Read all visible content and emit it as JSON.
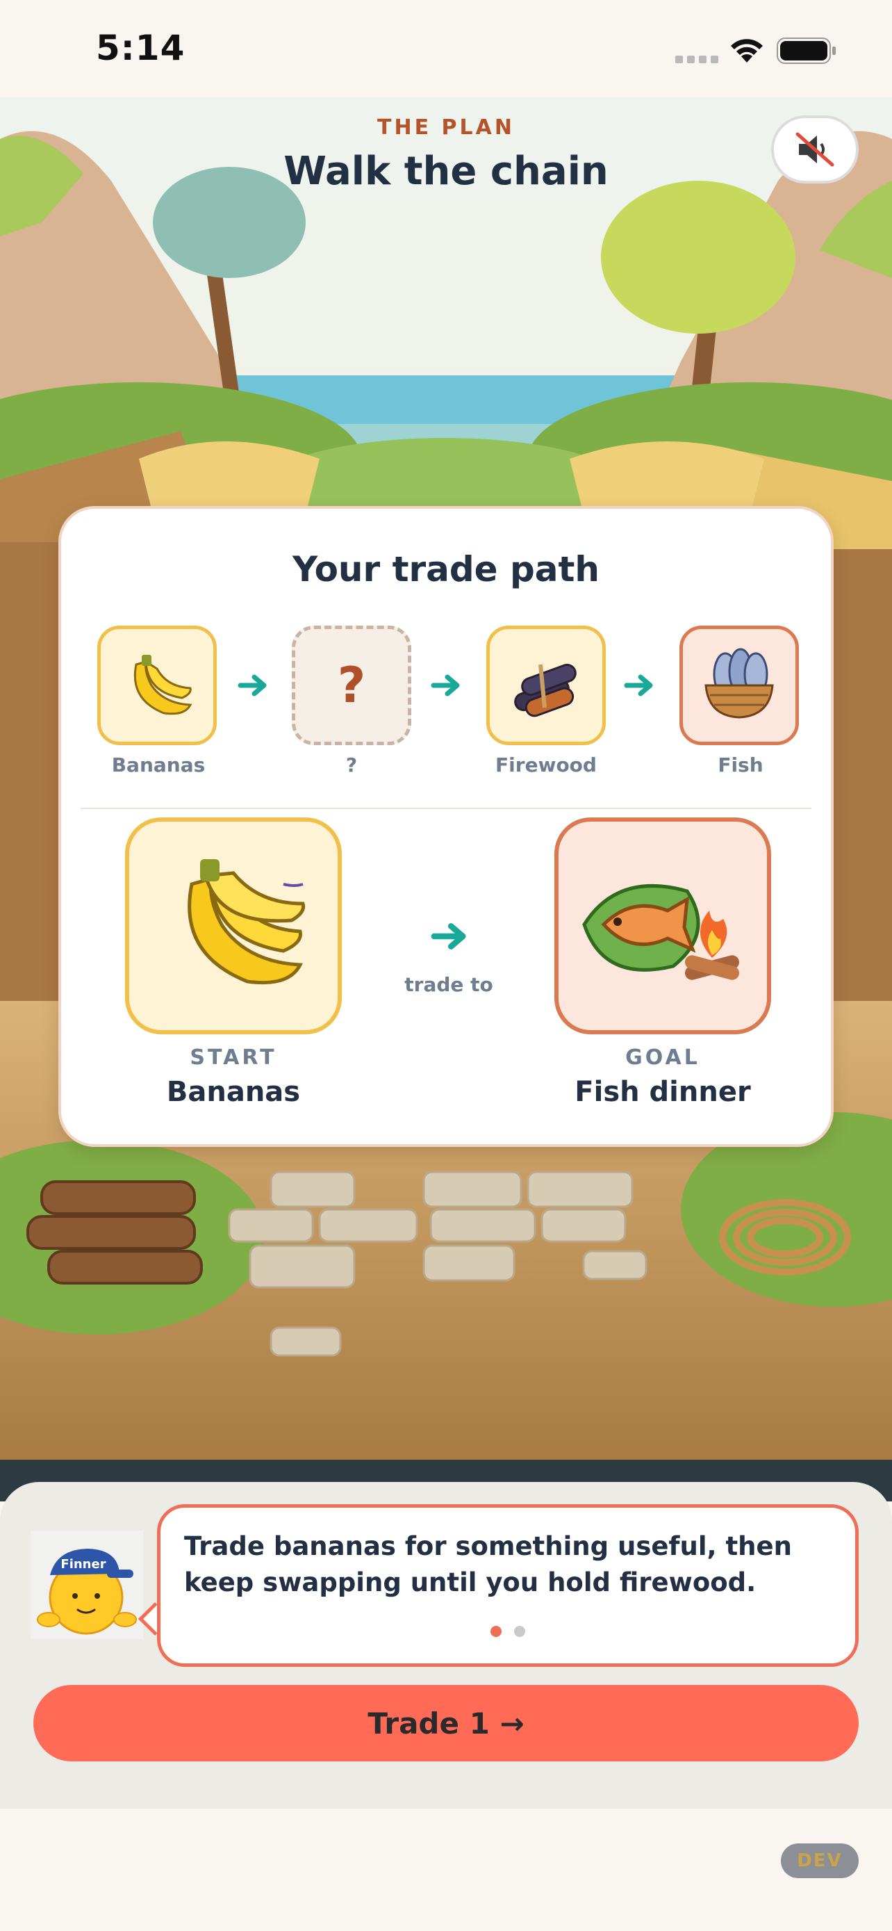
{
  "status_bar": {
    "time": "5:14"
  },
  "header": {
    "eyebrow": "THE PLAN",
    "title": "Walk the chain"
  },
  "card": {
    "title": "Your trade path",
    "path": [
      {
        "label": "Bananas",
        "icon": "banana-icon"
      },
      {
        "label": "?",
        "icon": "unknown-icon"
      },
      {
        "label": "Firewood",
        "icon": "firewood-icon"
      },
      {
        "label": "Fish",
        "icon": "fish-basket-icon"
      }
    ],
    "start": {
      "tag": "START",
      "name": "Bananas"
    },
    "connector": "trade to",
    "goal": {
      "tag": "GOAL",
      "name": "Fish dinner"
    }
  },
  "guide": {
    "mascot_name": "Finner",
    "message": "Trade bananas for something useful, then keep swapping until you hold firewood.",
    "page_count": 2,
    "active_page": 1
  },
  "cta": {
    "label": "Trade 1 →"
  },
  "dev_badge": "DEV",
  "colors": {
    "accent": "#ff6b57",
    "teal_arrow": "#1aa898",
    "title": "#233044",
    "eyebrow": "#b5542a"
  }
}
